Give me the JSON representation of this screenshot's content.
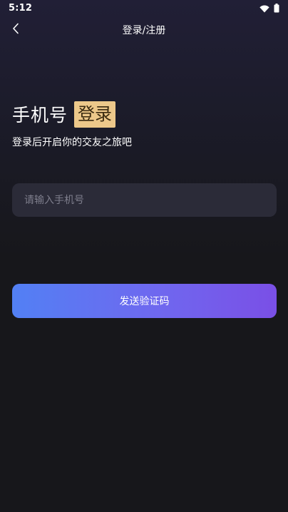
{
  "status_bar": {
    "time": "5:12",
    "icons": [
      "wifi-icon",
      "battery-icon"
    ]
  },
  "nav": {
    "title": "登录/注册",
    "back_icon": "chevron-left-icon"
  },
  "heading": {
    "main": "手机号",
    "tag": "登录",
    "tag_color": "#edc88a"
  },
  "subtitle": "登录后开启你的交友之旅吧",
  "phone_input": {
    "placeholder": "请输入手机号",
    "value": ""
  },
  "send_button": {
    "label": "发送验证码",
    "gradient_start": "#5280f4",
    "gradient_end": "#7a4fe6"
  }
}
